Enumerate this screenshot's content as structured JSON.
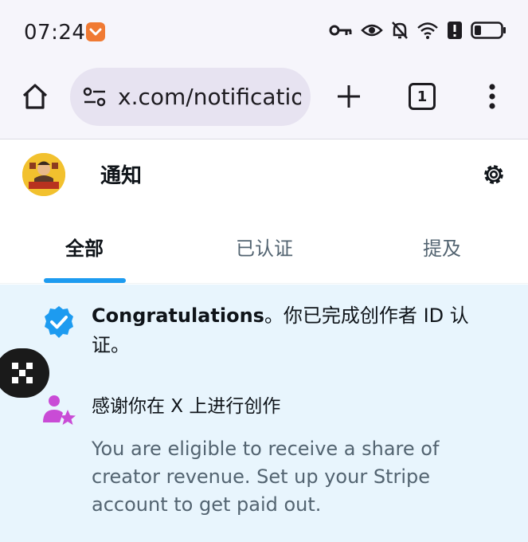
{
  "status_bar": {
    "time": "07:24",
    "icons": [
      "key-icon",
      "eye-icon",
      "bell-off-icon",
      "wifi-icon",
      "alert-icon",
      "battery-icon"
    ]
  },
  "browser": {
    "url": "x.com/notifications",
    "tab_count": "1"
  },
  "header": {
    "title": "通知"
  },
  "tabs": [
    {
      "label": "全部",
      "active": true
    },
    {
      "label": "已认证",
      "active": false
    },
    {
      "label": "提及",
      "active": false
    }
  ],
  "notifications": [
    {
      "strong": "Congratulations",
      "text": "。你已完成创作者 ID 认证。"
    },
    {
      "title": "感谢你在 X 上进行创作",
      "body": "You are eligible to receive a share of creator revenue. Set up your Stripe account to get paid out."
    }
  ],
  "colors": {
    "accent": "#1d9bf0",
    "highlight_bg": "#e8f5fd",
    "creator_icon": "#c94bd6"
  }
}
